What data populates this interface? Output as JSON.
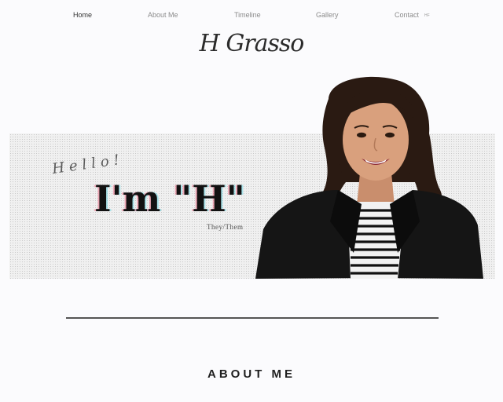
{
  "nav": {
    "items": [
      {
        "label": "Home",
        "active": true
      },
      {
        "label": "About Me",
        "active": false
      },
      {
        "label": "Timeline",
        "active": false
      },
      {
        "label": "Gallery",
        "active": false
      },
      {
        "label": "Contact",
        "active": false
      }
    ],
    "extra": "HF"
  },
  "site": {
    "title": "H Grasso"
  },
  "hero": {
    "greeting": "Hello!",
    "headline": "I'm \"H\"",
    "pronouns": "They/Them",
    "photo_icon": "portrait-photo"
  },
  "about": {
    "heading": "ABOUT ME"
  },
  "colors": {
    "background": "#fbfbfd",
    "nav_text": "#8b8b8b",
    "nav_active": "#333333",
    "divider": "#555555"
  }
}
